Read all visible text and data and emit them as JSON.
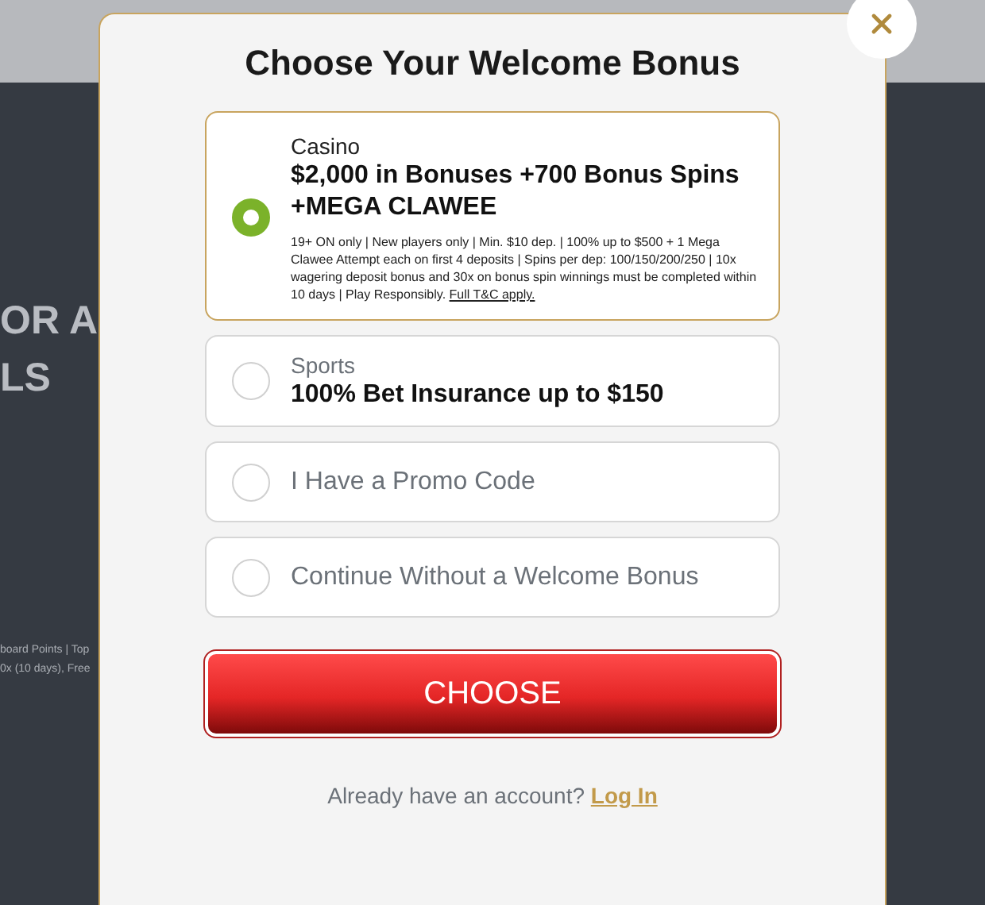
{
  "background": {
    "headline_lines": [
      "OR A",
      "LS"
    ],
    "fine_print_lines": [
      "board Points | Top",
      "0x (10 days), Free"
    ]
  },
  "modal": {
    "title": "Choose Your Welcome Bonus",
    "options": [
      {
        "kind": "offer",
        "category": "Casino",
        "headline": "$2,000 in Bonuses +700 Bonus Spins +MEGA CLAWEE",
        "terms": "19+ ON only | New players only | Min. $10 dep. | 100% up to $500 + 1 Mega Clawee Attempt each on first 4 deposits | Spins per dep: 100/150/200/250 | 10x wagering deposit bonus and 30x on bonus spin winnings must be completed within 10 days | Play Responsibly.",
        "terms_link": "Full T&C apply.",
        "selected": true
      },
      {
        "kind": "offer",
        "category": "Sports",
        "headline": "100% Bet Insurance up to $150",
        "selected": false
      },
      {
        "kind": "plain",
        "label": "I Have a Promo Code",
        "selected": false
      },
      {
        "kind": "plain",
        "label": "Continue Without a Welcome Bonus",
        "selected": false
      }
    ],
    "button": "CHOOSE",
    "login_prompt": "Already have an account?",
    "login_link": "Log In"
  }
}
